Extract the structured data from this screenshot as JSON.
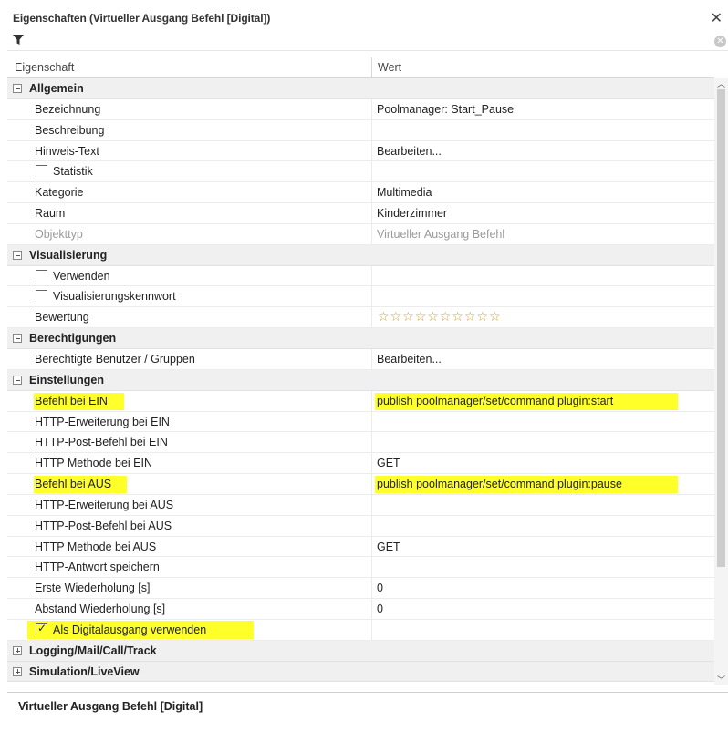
{
  "window": {
    "title": "Eigenschaften (Virtueller Ausgang Befehl [Digital])"
  },
  "columns": {
    "property": "Eigenschaft",
    "value": "Wert"
  },
  "categories": {
    "allgemein": "Allgemein",
    "visualisierung": "Visualisierung",
    "berechtigungen": "Berechtigungen",
    "einstellungen": "Einstellungen",
    "logging": "Logging/Mail/Call/Track",
    "simulation": "Simulation/LiveView"
  },
  "allgemein": [
    {
      "name": "Bezeichnung",
      "value": "Poolmanager: Start_Pause"
    },
    {
      "name": "Beschreibung",
      "value": ""
    },
    {
      "name": "Hinweis-Text",
      "value": "Bearbeiten..."
    },
    {
      "name": "Statistik",
      "value": ""
    },
    {
      "name": "Kategorie",
      "value": "Multimedia"
    },
    {
      "name": "Raum",
      "value": "Kinderzimmer"
    },
    {
      "name": "Objekttyp",
      "value": "Virtueller Ausgang Befehl"
    }
  ],
  "visualisierung": [
    {
      "name": "Verwenden",
      "value": ""
    },
    {
      "name": "Visualisierungskennwort",
      "value": ""
    },
    {
      "name": "Bewertung",
      "value": ""
    }
  ],
  "rating": {
    "stars_total": 10,
    "stars_filled": 0
  },
  "berechtigungen": [
    {
      "name": "Berechtigte Benutzer / Gruppen",
      "value": "Bearbeiten..."
    }
  ],
  "einstellungen": [
    {
      "name": "Befehl bei EIN",
      "value": "publish poolmanager/set/command plugin:start"
    },
    {
      "name": "HTTP-Erweiterung bei EIN",
      "value": ""
    },
    {
      "name": "HTTP-Post-Befehl bei EIN",
      "value": ""
    },
    {
      "name": "HTTP Methode bei EIN",
      "value": "GET"
    },
    {
      "name": "Befehl bei AUS",
      "value": "publish poolmanager/set/command plugin:pause"
    },
    {
      "name": "HTTP-Erweiterung bei AUS",
      "value": ""
    },
    {
      "name": "HTTP-Post-Befehl bei AUS",
      "value": ""
    },
    {
      "name": "HTTP Methode bei AUS",
      "value": "GET"
    },
    {
      "name": "HTTP-Antwort speichern",
      "value": ""
    },
    {
      "name": "Erste Wiederholung [s]",
      "value": "0"
    },
    {
      "name": "Abstand Wiederholung [s]",
      "value": "0"
    },
    {
      "name": "Als Digitalausgang verwenden",
      "value": ""
    }
  ],
  "checkboxes": {
    "statistik": false,
    "verwenden": false,
    "visualisierungskennwort": false,
    "als_digitalausgang": true
  },
  "highlight_color": "#ffff2a",
  "description": {
    "title": "Virtueller Ausgang Befehl [Digital]"
  }
}
